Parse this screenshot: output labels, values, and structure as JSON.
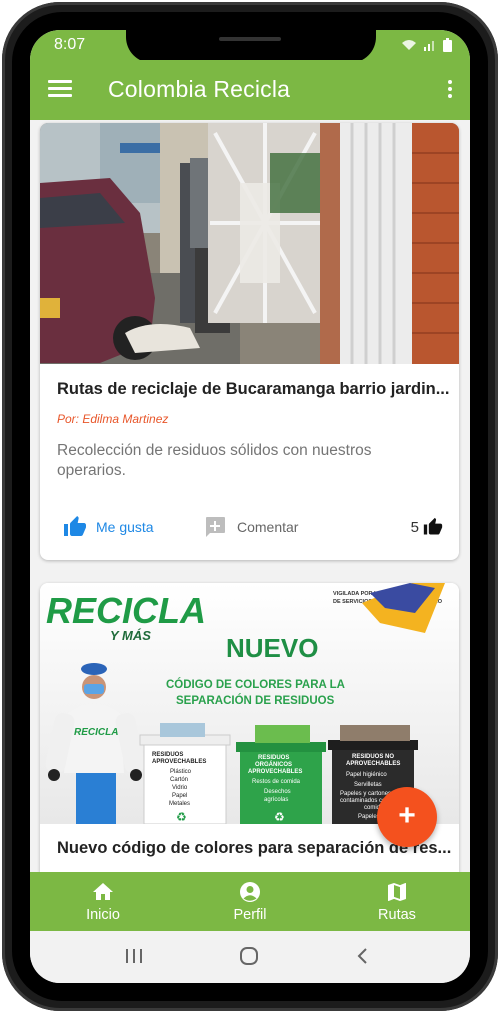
{
  "status_bar": {
    "time": "8:07"
  },
  "app_bar": {
    "title": "Colombia Recicla"
  },
  "posts": [
    {
      "title": "Rutas de reciclaje de Bucaramanga barrio jardin...",
      "author": "Por: Edilma Martinez",
      "description": "Recolección de residuos sólidos con nuestros operarios.",
      "like_label": "Me gusta",
      "comment_label": "Comentar",
      "like_count": "5"
    },
    {
      "title": "Nuevo código de colores para separación de res...",
      "image_text": {
        "logo_main": "RECICLA",
        "logo_sub": "Y MÁS",
        "vigilada_line1": "VIGILADA POR LA SUPERINTENDENCIA",
        "vigilada_line2": "DE SERVICIOS PÚBLICOS DOMICILIARIO",
        "headline": "NUEVO",
        "subheadline_line1": "CÓDIGO DE COLORES PARA LA",
        "subheadline_line2": "SEPARACIÓN DE RESIDUOS",
        "bins": [
          {
            "title_line1": "RESIDUOS",
            "title_line2": "APROVECHABLES",
            "items": [
              "Plástico",
              "Cartón",
              "Vidrio",
              "Papel",
              "Metales"
            ]
          },
          {
            "title_line1": "RESIDUOS",
            "title_line2": "ORGÁNICOS",
            "title_line3": "APROVECHABLES",
            "items": [
              "Restos de comida",
              "Desechos",
              "agrícolas"
            ]
          },
          {
            "title_line1": "RESIDUOS NO",
            "title_line2": "APROVECHABLES",
            "items": [
              "Papel higiénico",
              "Servilletas",
              "Papeles y cartones",
              "contaminados con",
              "comida",
              "Papeles"
            ]
          }
        ]
      }
    }
  ],
  "fab": {
    "label": "+"
  },
  "bottom_nav": [
    {
      "label": "Inicio",
      "icon": "home-icon"
    },
    {
      "label": "Perfil",
      "icon": "account-icon"
    },
    {
      "label": "Rutas",
      "icon": "map-icon"
    }
  ],
  "colors": {
    "primary": "#7cb844",
    "accent": "#f4511e",
    "like_blue": "#1e88e5",
    "author_orange": "#e8562a"
  }
}
